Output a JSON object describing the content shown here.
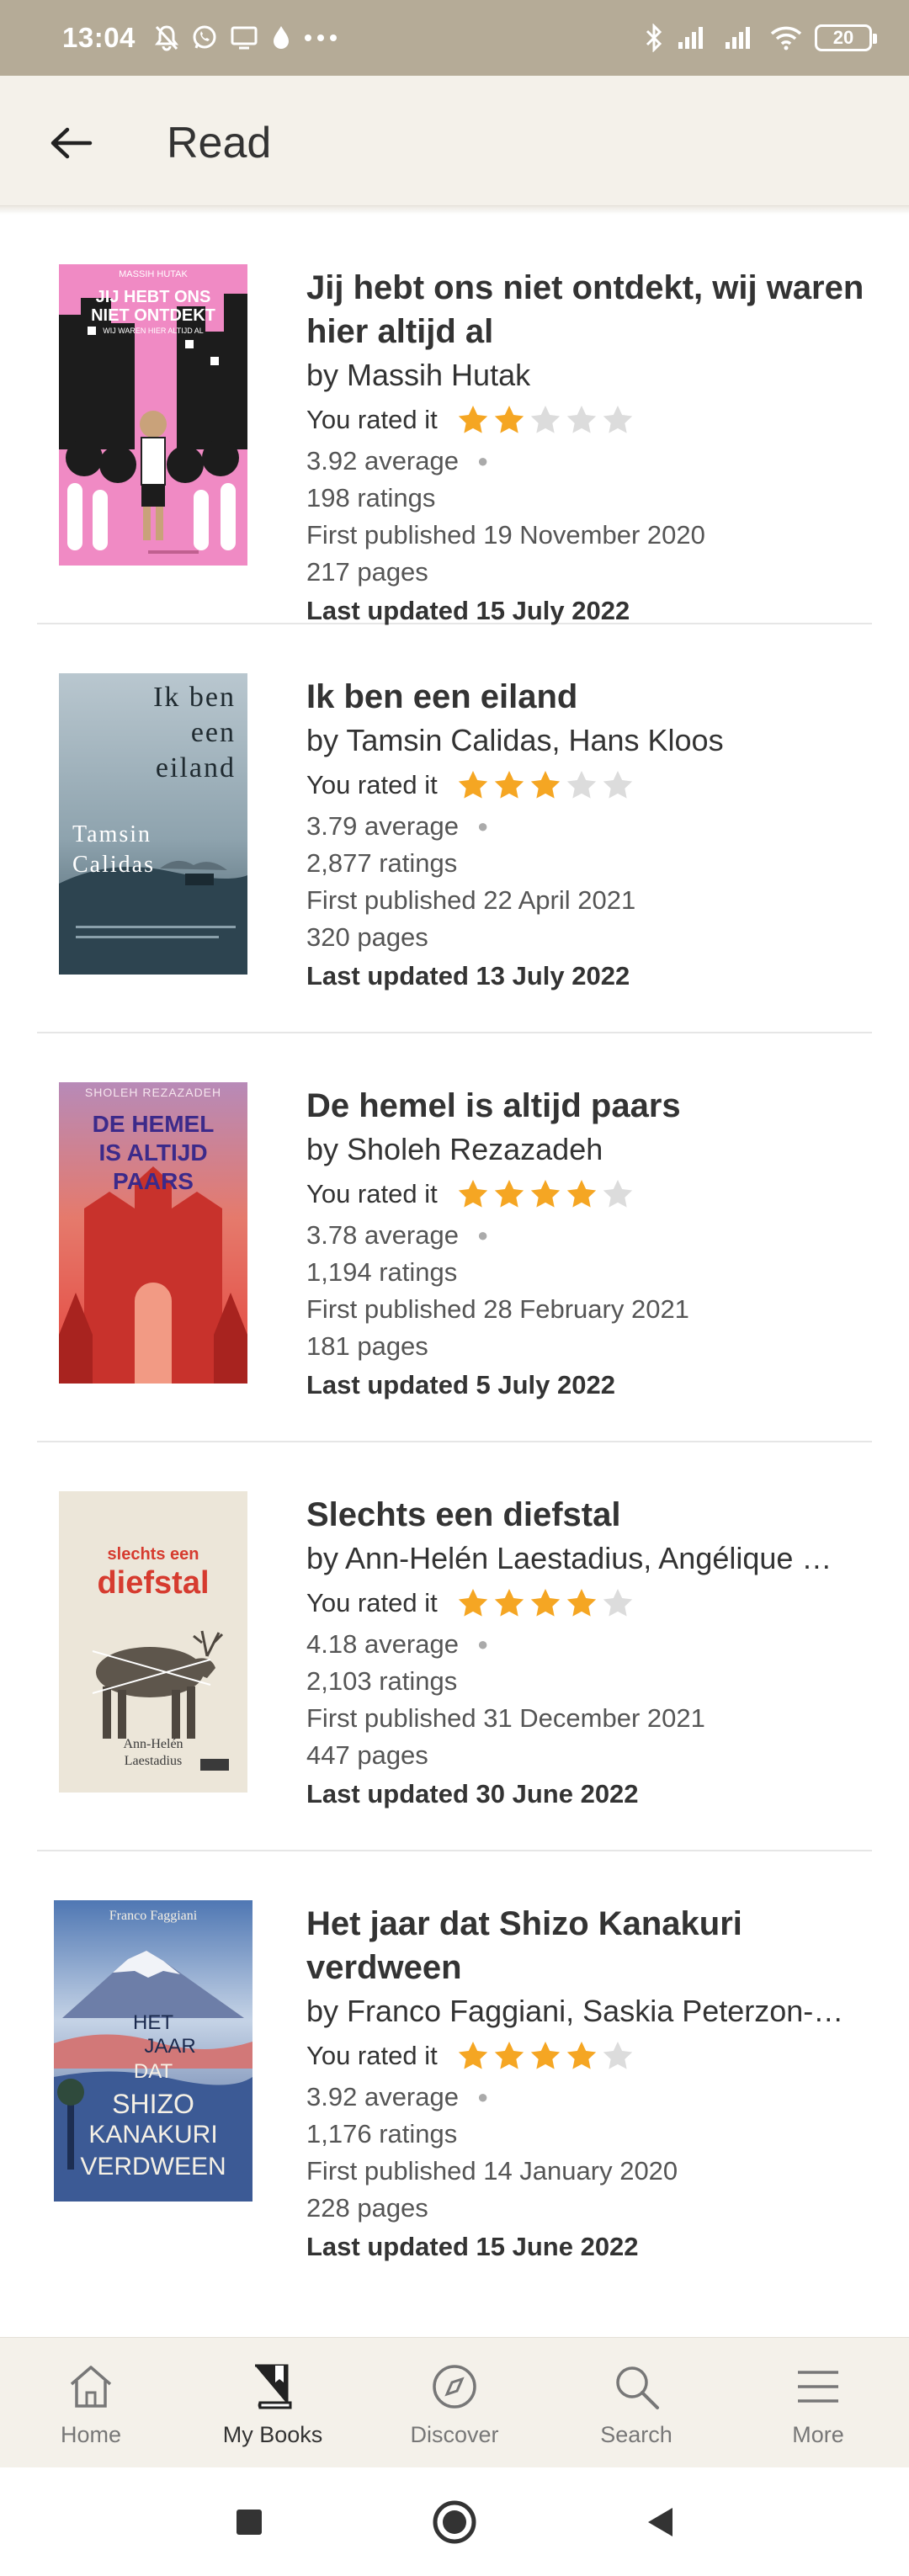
{
  "status_bar": {
    "time": "13:04",
    "battery": "20",
    "more_icon": "more-dots-icon",
    "left_icons": [
      "mute-notifications-icon",
      "whatsapp-icon",
      "screen-cast-icon",
      "water-drop-icon"
    ],
    "right_icons": [
      "bluetooth-icon",
      "signal-icon",
      "signal-icon",
      "wifi-icon",
      "battery-icon"
    ]
  },
  "app_bar": {
    "title": "Read",
    "back_icon": "arrow-left-icon"
  },
  "colors": {
    "header_bg": "#f4f1ea",
    "status_bg": "#b5ab97",
    "star_filled": "#f5a623",
    "star_empty": "#dcdcdc",
    "text": "#333333"
  },
  "books": [
    {
      "title": "Jij hebt ons niet ontdekt, wij waren hier altijd al",
      "author": "by Massih Hutak",
      "rated_label": "You rated it",
      "rating": 2,
      "average": "3.92 average",
      "ratings": "198 ratings",
      "published": "First published 19 November 2020",
      "pages": "217 pages",
      "updated": "Last updated 15 July 2022",
      "cover": {
        "top_text": "MASSIH HUTAK",
        "title_lines": [
          "JIJ HEBT ONS",
          "NIET ONTDEKT"
        ],
        "subtitle": "WIJ WAREN HIER ALTIJD AL",
        "bg": "#f08ac4"
      }
    },
    {
      "title": "Ik ben een eiland",
      "author": "by Tamsin Calidas, Hans Kloos",
      "rated_label": "You rated it",
      "rating": 3,
      "average": "3.79 average",
      "ratings": "2,877 ratings",
      "published": "First published 22 April 2021",
      "pages": "320 pages",
      "updated": "Last updated 13 July 2022",
      "cover": {
        "title_lines": [
          "Ik ben",
          "een",
          "eiland"
        ],
        "author_lines": [
          "Tamsin",
          "Calidas"
        ],
        "bg": "#8a9fae"
      }
    },
    {
      "title": "De hemel is altijd paars",
      "author": "by Sholeh Rezazadeh",
      "rated_label": "You rated it",
      "rating": 4,
      "average": "3.78 average",
      "ratings": "1,194 ratings",
      "published": "First published 28 February 2021",
      "pages": "181 pages",
      "updated": "Last updated 5 July 2022",
      "cover": {
        "top_text": "SHOLEH REZAZADEH",
        "title_lines": [
          "DE HEMEL",
          "IS ALTIJD",
          "PAARS"
        ],
        "bg": "#e5504a"
      }
    },
    {
      "title": "Slechts een diefstal",
      "author": "by Ann-Helén Laestadius, Angélique …",
      "rated_label": "You rated it",
      "rating": 4,
      "average": "4.18 average",
      "ratings": "2,103 ratings",
      "published": "First published 31 December 2021",
      "pages": "447 pages",
      "updated": "Last updated 30 June 2022",
      "cover": {
        "title_lines": [
          "slechts een",
          "diefstal"
        ],
        "author_lines": [
          "Ann-Helén",
          "Laestadius"
        ],
        "bg": "#ece6d9"
      }
    },
    {
      "title": "Het jaar dat Shizo Kanakuri verdween",
      "author": "by Franco Faggiani, Saskia Peterzon-…",
      "rated_label": "You rated it",
      "rating": 4,
      "average": "3.92 average",
      "ratings": "1,176 ratings",
      "published": "First published 14 January 2020",
      "pages": "228 pages",
      "updated": "Last updated 15 June 2022",
      "cover": {
        "top_text": "Franco Faggiani",
        "title_lines": [
          "HET",
          "JAAR",
          "DAT",
          "SHIZO",
          "KANAKURI",
          "VERDWEEN"
        ],
        "bg": "#7da0c8"
      }
    }
  ],
  "bottom_nav": [
    {
      "label": "Home",
      "icon": "home-icon",
      "active": false
    },
    {
      "label": "My Books",
      "icon": "book-icon",
      "active": true
    },
    {
      "label": "Discover",
      "icon": "compass-icon",
      "active": false
    },
    {
      "label": "Search",
      "icon": "search-icon",
      "active": false
    },
    {
      "label": "More",
      "icon": "menu-icon",
      "active": false
    }
  ],
  "system_nav": [
    "recents-square-icon",
    "home-circle-icon",
    "back-triangle-icon"
  ]
}
